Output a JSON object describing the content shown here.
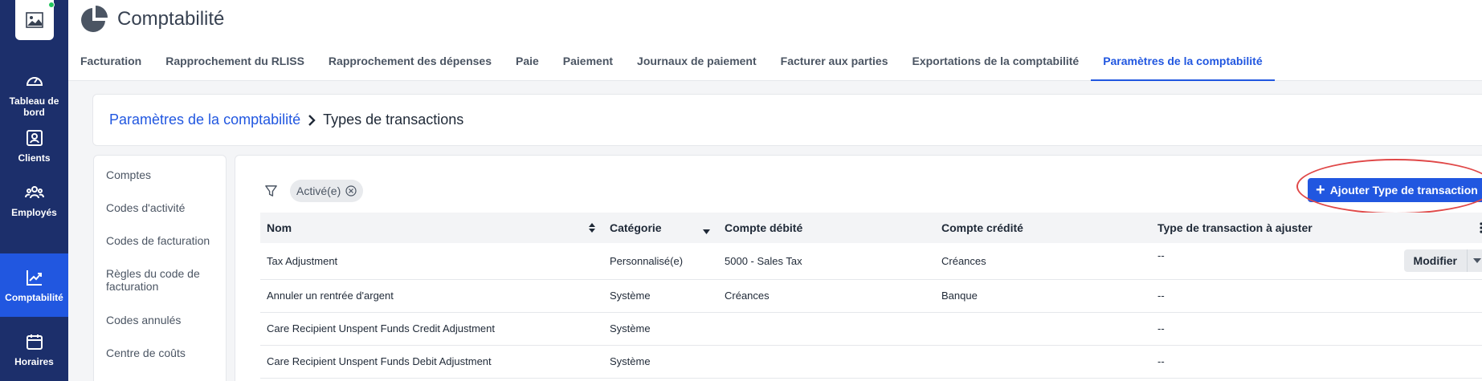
{
  "app": {
    "title": "Comptabilité"
  },
  "sidebar": {
    "items": [
      {
        "label": "Tableau de bord",
        "icon": "gauge-icon",
        "active": false
      },
      {
        "label": "Clients",
        "icon": "client-card-icon",
        "active": false
      },
      {
        "label": "Employés",
        "icon": "people-group-icon",
        "active": false
      },
      {
        "label": "Comptabilité",
        "icon": "trend-chart-icon",
        "active": true
      },
      {
        "label": "Horaires",
        "icon": "calendar-icon",
        "active": false
      }
    ]
  },
  "tabs": [
    {
      "label": "Facturation",
      "active": false
    },
    {
      "label": "Rapprochement du RLISS",
      "active": false
    },
    {
      "label": "Rapprochement des dépenses",
      "active": false
    },
    {
      "label": "Paie",
      "active": false
    },
    {
      "label": "Paiement",
      "active": false
    },
    {
      "label": "Journaux de paiement",
      "active": false
    },
    {
      "label": "Facturer aux parties",
      "active": false
    },
    {
      "label": "Exportations de la comptabilité",
      "active": false
    },
    {
      "label": "Paramètres de la comptabilité",
      "active": true
    }
  ],
  "breadcrumb": {
    "parent": "Paramètres de la comptabilité",
    "current": "Types de transactions"
  },
  "settings_menu": [
    "Comptes",
    "Codes d'activité",
    "Codes de facturation",
    "Règles du code de facturation",
    "Codes annulés",
    "Centre de coûts"
  ],
  "filter": {
    "chip_label": "Activé(e)"
  },
  "add_button_label": "Ajouter Type de transaction",
  "table": {
    "headers": [
      "Nom",
      "Catégorie",
      "Compte débité",
      "Compte crédité",
      "Type de transaction à ajuster"
    ],
    "rows": [
      [
        "Tax Adjustment",
        "Personnalisé(e)",
        "5000 - Sales Tax",
        "Créances",
        "--"
      ],
      [
        "Annuler un rentrée d'argent",
        "Système",
        "Créances",
        "Banque",
        "--"
      ],
      [
        "Care Recipient Unspent Funds Credit Adjustment",
        "Système",
        "",
        "",
        "--"
      ],
      [
        "Care Recipient Unspent Funds Debit Adjustment",
        "Système",
        "",
        "",
        "--"
      ]
    ],
    "edit_label": "Modifier"
  },
  "colors": {
    "sidebar": "#1c2f6b",
    "accent": "#2157e0",
    "highlight": "#e04848"
  }
}
